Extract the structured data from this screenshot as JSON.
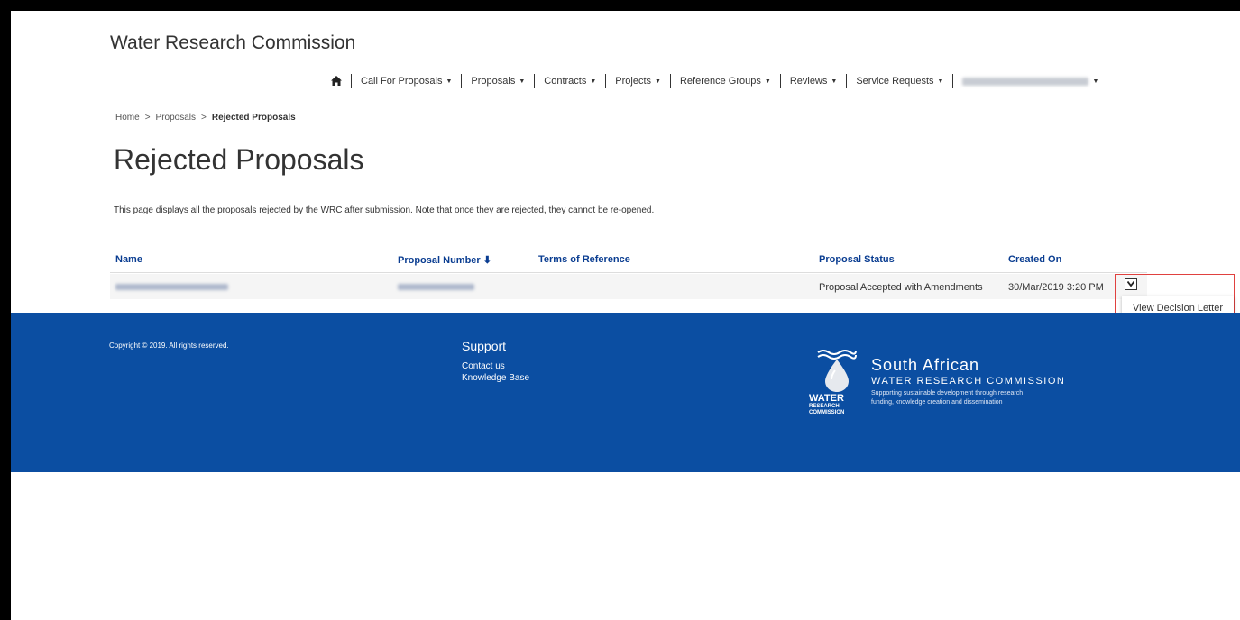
{
  "brand": "Water Research Commission",
  "nav": {
    "home_icon": "home-icon",
    "items": [
      "Call For Proposals",
      "Proposals",
      "Contracts",
      "Projects",
      "Reference Groups",
      "Reviews",
      "Service Requests"
    ]
  },
  "breadcrumb": {
    "home": "Home",
    "sep": ">",
    "proposals": "Proposals",
    "current": "Rejected Proposals"
  },
  "page": {
    "title": "Rejected Proposals",
    "description": "This page displays all the proposals rejected by the WRC after submission. Note that once they are rejected, they cannot be re-opened."
  },
  "table": {
    "columns": [
      "Name",
      "Proposal Number ⬇",
      "Terms of Reference",
      "Proposal Status",
      "Created On"
    ],
    "rows": [
      {
        "status": "Proposal Accepted with Amendments",
        "created_on": "30/Mar/2019 3:20 PM"
      }
    ]
  },
  "dropdown": {
    "item": "View Decision Letter"
  },
  "footer": {
    "copyright": "Copyright © 2019. All rights reserved.",
    "support_title": "Support",
    "links": [
      "Contact us",
      "Knowledge Base"
    ],
    "logo": {
      "water": "WATER",
      "research": "RESEARCH",
      "commission": "COMMISSION",
      "south_african": "South African",
      "wrc": "WATER RESEARCH COMMISSION",
      "tagline1": "Supporting sustainable development through research",
      "tagline2": "funding, knowledge creation and dissemination"
    }
  },
  "colors": {
    "footer_bg": "#0b4ea2",
    "header_blue": "#0a3d91",
    "highlight": "#e0413f"
  }
}
